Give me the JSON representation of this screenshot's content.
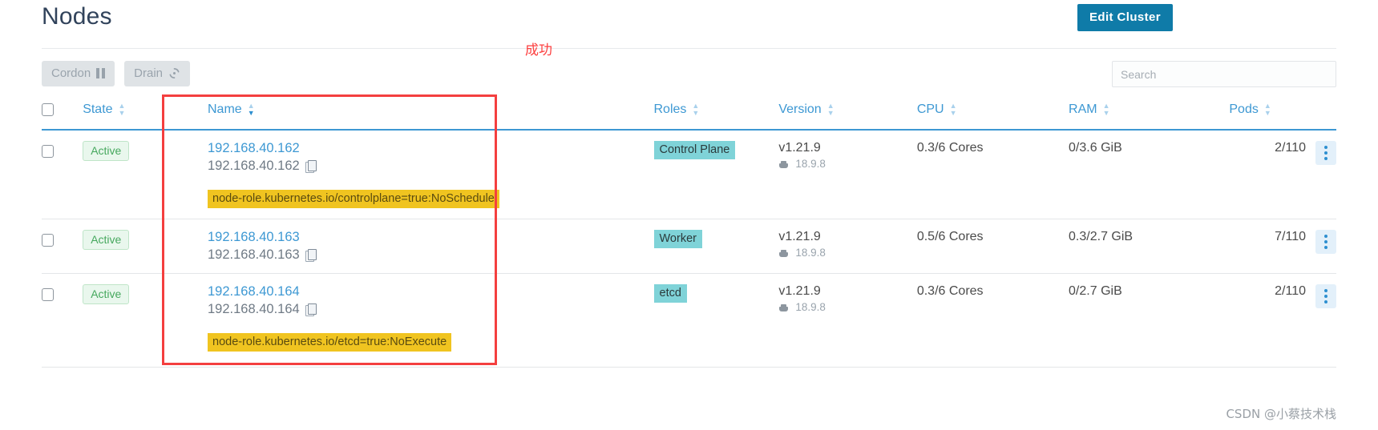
{
  "header": {
    "title": "Nodes",
    "edit_cluster_label": "Edit Cluster"
  },
  "annotation": {
    "success_text": "成功",
    "success_color": "#fc4040",
    "highlight_box_color": "#f43f3f"
  },
  "toolbar": {
    "cordon_label": "Cordon",
    "drain_label": "Drain",
    "search_placeholder": "Search",
    "search_value": ""
  },
  "table": {
    "columns": [
      {
        "label": "State",
        "sort": "inactive"
      },
      {
        "label": "Name",
        "sort": "active-desc"
      },
      {
        "label": "Roles",
        "sort": "inactive"
      },
      {
        "label": "Version",
        "sort": "inactive"
      },
      {
        "label": "CPU",
        "sort": "inactive"
      },
      {
        "label": "RAM",
        "sort": "inactive"
      },
      {
        "label": "Pods",
        "sort": "inactive"
      }
    ],
    "rows": [
      {
        "state": "Active",
        "name": "192.168.40.162",
        "ip": "192.168.40.162",
        "taint": "node-role.kubernetes.io/controlplane=true:NoSchedule",
        "role": "Control Plane",
        "version": "v1.21.9",
        "docker_version": "18.9.8",
        "cpu": "0.3/6 Cores",
        "ram": "0/3.6 GiB",
        "pods": "2/110"
      },
      {
        "state": "Active",
        "name": "192.168.40.163",
        "ip": "192.168.40.163",
        "taint": "",
        "role": "Worker",
        "version": "v1.21.9",
        "docker_version": "18.9.8",
        "cpu": "0.5/6 Cores",
        "ram": "0.3/2.7 GiB",
        "pods": "7/110"
      },
      {
        "state": "Active",
        "name": "192.168.40.164",
        "ip": "192.168.40.164",
        "taint": "node-role.kubernetes.io/etcd=true:NoExecute",
        "role": "etcd",
        "version": "v1.21.9",
        "docker_version": "18.9.8",
        "cpu": "0.3/6 Cores",
        "ram": "0/2.7 GiB",
        "pods": "2/110"
      }
    ]
  },
  "watermark": "CSDN @小蔡技术栈",
  "colors": {
    "accent_blue": "#3d98d3",
    "button_blue": "#0f7ba8",
    "badge_green_text": "#46a85e",
    "badge_green_bg": "#e9f7ed",
    "role_badge_bg": "#7fd3d8",
    "taint_bg": "#f0c420"
  }
}
